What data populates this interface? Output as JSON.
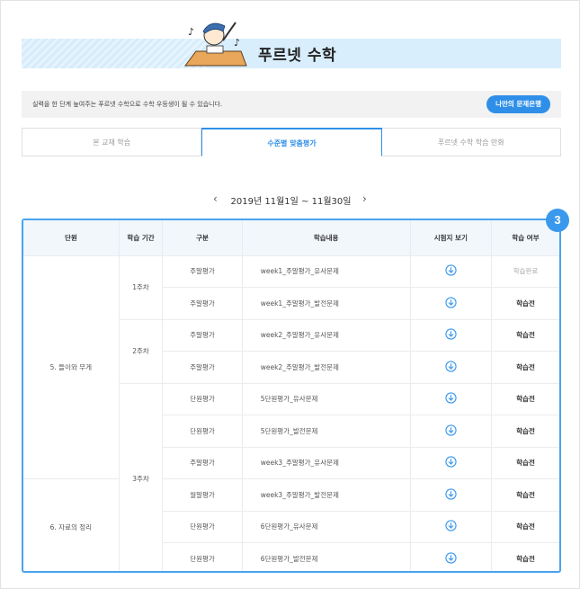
{
  "header": {
    "title": "푸르넷 수학"
  },
  "infobar": {
    "text": "실력을 한 단계 높여주는 푸르넷 수학으로 수학 우등생이 될 수 있습니다.",
    "button_label": "나만의 문제은행"
  },
  "tabs": [
    {
      "label": "본 교재 학습",
      "active": false
    },
    {
      "label": "수준별 맞춤평가",
      "active": true
    },
    {
      "label": "푸르넷 수학 학습 만화",
      "active": false
    }
  ],
  "period": {
    "label": "2019년 11월1일 ~ 11월30일"
  },
  "badge": "3",
  "table": {
    "headers": [
      "단원",
      "학습 기간",
      "구분",
      "학습내용",
      "시험지 보기",
      "학습 여부"
    ],
    "units": [
      "5. 들이와 무게",
      "6. 자료의 정리"
    ],
    "weeks": [
      "1주차",
      "2주차",
      "3주차"
    ],
    "rows": [
      {
        "type": "주말평가",
        "content": "week1_주말평가_유사문제",
        "status": "학습완료"
      },
      {
        "type": "주말평가",
        "content": "week1_주말평가_발전문제",
        "status": "학습전"
      },
      {
        "type": "주말평가",
        "content": "week2_주말평가_유사문제",
        "status": "학습전"
      },
      {
        "type": "주말평가",
        "content": "week2_주말평가_발전문제",
        "status": "학습전"
      },
      {
        "type": "단원평가",
        "content": "5단원평가_유사문제",
        "status": "학습전"
      },
      {
        "type": "단원평가",
        "content": "5단원평가_발전문제",
        "status": "학습전"
      },
      {
        "type": "주말평가",
        "content": "week3_주말평가_유사문제",
        "status": "학습전"
      },
      {
        "type": "월말평가",
        "content": "week3_주말평가_발전문제",
        "status": "학습전"
      },
      {
        "type": "단원평가",
        "content": "6단원평가_유사문제",
        "status": "학습전"
      },
      {
        "type": "단원평가",
        "content": "6단원평가_발전문제",
        "status": "학습전"
      }
    ]
  },
  "colors": {
    "accent": "#2f8fe8",
    "border": "#4aa3f0",
    "header_bg": "#f2f7fc"
  }
}
